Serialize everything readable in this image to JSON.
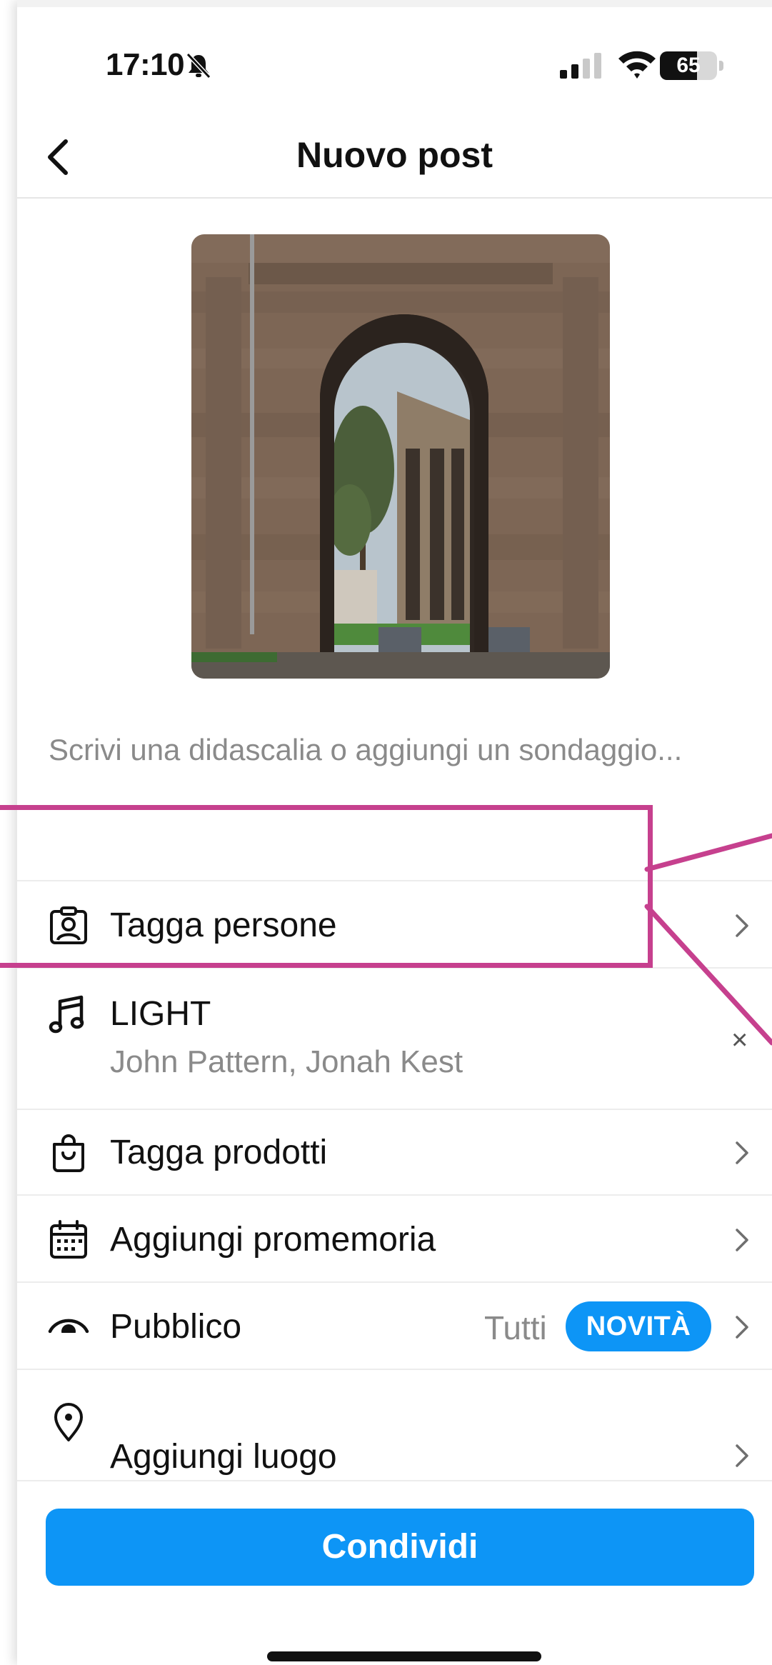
{
  "status_bar": {
    "time": "17:10",
    "battery_percent": "65",
    "battery_level": 0.65
  },
  "nav": {
    "title": "Nuovo post",
    "back_icon": "chevron-left-icon"
  },
  "caption": {
    "placeholder": "Scrivi una didascalia o aggiungi un sondaggio..."
  },
  "options": {
    "tag_people": {
      "label": "Tagga persone",
      "icon": "person-tag-icon"
    },
    "music": {
      "title": "LIGHT",
      "artists": "John Pattern, Jonah Kest",
      "icon": "music-note-icon",
      "remove": "×"
    },
    "tag_products": {
      "label": "Tagga prodotti",
      "icon": "shopping-bag-icon"
    },
    "reminder": {
      "label": "Aggiungi promemoria",
      "icon": "calendar-icon"
    },
    "audience": {
      "label": "Pubblico",
      "value": "Tutti",
      "badge": "NOVITÀ",
      "icon": "eye-icon"
    },
    "location": {
      "label": "Aggiungi luogo",
      "icon": "location-pin-icon"
    }
  },
  "share_button": {
    "label": "Condividi"
  },
  "colors": {
    "accent": "#0d95f6",
    "annotation": "#c6408e",
    "secondary_text": "#8a8a8a"
  }
}
